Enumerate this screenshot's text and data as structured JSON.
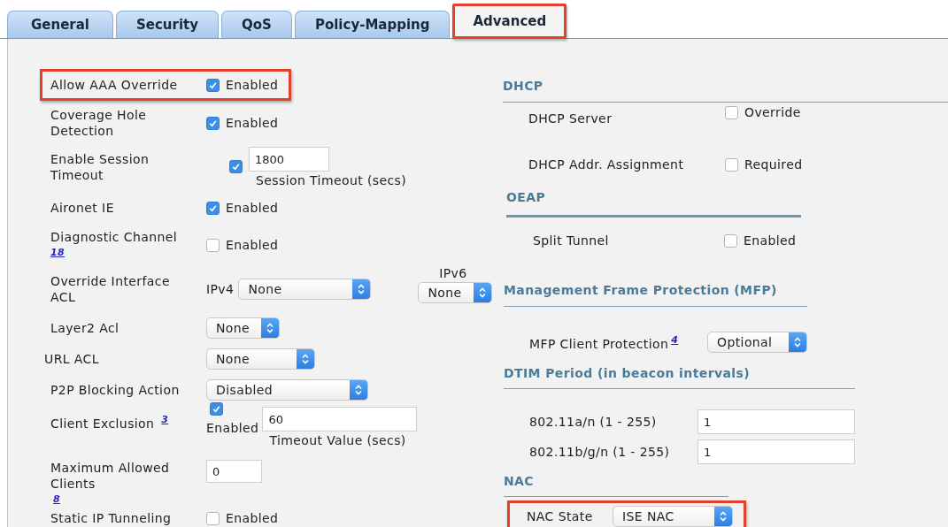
{
  "tabs": [
    {
      "label": "General",
      "selected": false,
      "highlighted": false
    },
    {
      "label": "Security",
      "selected": false,
      "highlighted": false
    },
    {
      "label": "QoS",
      "selected": false,
      "highlighted": false
    },
    {
      "label": "Policy-Mapping",
      "selected": false,
      "highlighted": false
    },
    {
      "label": "Advanced",
      "selected": true,
      "highlighted": true
    }
  ],
  "left_rows": [
    {
      "kind": "checkbox",
      "label": "Allow AAA Override",
      "checked": true,
      "option": "Enabled",
      "highlighted": true
    },
    {
      "kind": "checkbox",
      "label": "Coverage Hole Detection",
      "checked": true,
      "option": "Enabled",
      "highlighted": false
    },
    {
      "kind": "timeout",
      "label": "Enable Session Timeout",
      "checked": true,
      "value": "1800",
      "caption": "Session Timeout (secs)"
    },
    {
      "kind": "checkbox",
      "label": "Aironet IE",
      "checked": true,
      "option": "Enabled",
      "highlighted": false
    },
    {
      "kind": "checkbox",
      "label": "Diagnostic Channel",
      "footnote": "18",
      "checked": false,
      "option": "Enabled",
      "highlighted": false
    },
    {
      "kind": "dual_select",
      "label": "Override Interface ACL",
      "selects": [
        {
          "prefix": "IPv4",
          "value": "None"
        },
        {
          "prefix": "IPv6",
          "value": "None"
        }
      ]
    },
    {
      "kind": "select",
      "label": "Layer2 Acl",
      "value": "None"
    },
    {
      "kind": "select",
      "label": "URL ACL",
      "value": "None"
    },
    {
      "kind": "select",
      "label": "P2P Blocking Action",
      "value": "Disabled"
    },
    {
      "kind": "exclusion",
      "label": "Client Exclusion",
      "footnote": "3",
      "checked": true,
      "option": "Enabled",
      "value": "60",
      "caption": "Timeout Value (secs)"
    },
    {
      "kind": "number",
      "label": "Maximum Allowed Clients",
      "footnote": "8",
      "value": "0"
    },
    {
      "kind": "checkbox",
      "label": "Static IP Tunneling",
      "checked": false,
      "option": "Enabled",
      "highlighted": false
    }
  ],
  "right_sections": [
    {
      "heading": "DHCP",
      "rows": [
        {
          "kind": "checkbox",
          "label": "DHCP Server",
          "checked": false,
          "option": "Override"
        },
        {
          "kind": "checkbox",
          "label": "DHCP Addr. Assignment",
          "checked": false,
          "option": "Required"
        }
      ]
    },
    {
      "heading": "OEAP",
      "rows": [
        {
          "kind": "checkbox",
          "label": "Split Tunnel",
          "checked": false,
          "option": "Enabled"
        }
      ]
    },
    {
      "heading": "Management Frame Protection (MFP)",
      "rows": [
        {
          "kind": "select",
          "label": "MFP Client Protection",
          "footnote": "4",
          "value": "Optional",
          "highlighted": false
        }
      ]
    },
    {
      "heading": "DTIM Period (in beacon intervals)",
      "rows": [
        {
          "kind": "input",
          "label": "802.11a/n (1 - 255)",
          "value": "1"
        },
        {
          "kind": "input",
          "label": "802.11b/g/n (1 - 255)",
          "value": "1"
        }
      ]
    },
    {
      "heading": "NAC",
      "rows": [
        {
          "kind": "select",
          "label": "NAC State",
          "value": "ISE NAC",
          "highlighted": true
        }
      ]
    }
  ]
}
